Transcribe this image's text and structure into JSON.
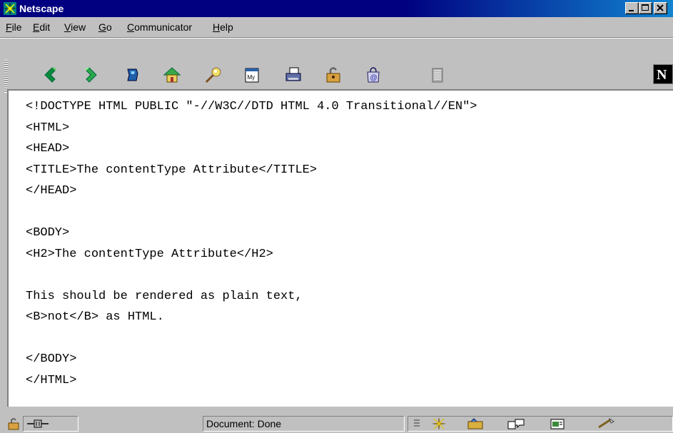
{
  "window": {
    "title": "Netscape"
  },
  "menu": {
    "items": [
      {
        "pre": "",
        "u": "F",
        "post": "ile"
      },
      {
        "pre": "",
        "u": "E",
        "post": "dit"
      },
      {
        "pre": "",
        "u": "V",
        "post": "iew"
      },
      {
        "pre": "",
        "u": "G",
        "post": "o"
      },
      {
        "pre": "",
        "u": "C",
        "post": "ommunicator"
      },
      {
        "pre": "",
        "u": "H",
        "post": "elp"
      }
    ]
  },
  "toolbar": {
    "buttons": [
      "back-icon",
      "forward-icon",
      "reload-icon",
      "home-icon",
      "search-icon",
      "my-netscape-icon",
      "print-icon",
      "security-icon",
      "shop-icon",
      "stop-icon"
    ],
    "logo_letter": "N"
  },
  "document": {
    "source": "<!DOCTYPE HTML PUBLIC \"-//W3C//DTD HTML 4.0 Transitional//EN\">\n<HTML>\n<HEAD>\n<TITLE>The contentType Attribute</TITLE>\n</HEAD>\n\n<BODY>\n<H2>The contentType Attribute</H2>\n\nThis should be rendered as plain text,\n<B>not</B> as HTML.\n\n</BODY>\n</HTML>"
  },
  "status": {
    "text": "Document: Done"
  }
}
